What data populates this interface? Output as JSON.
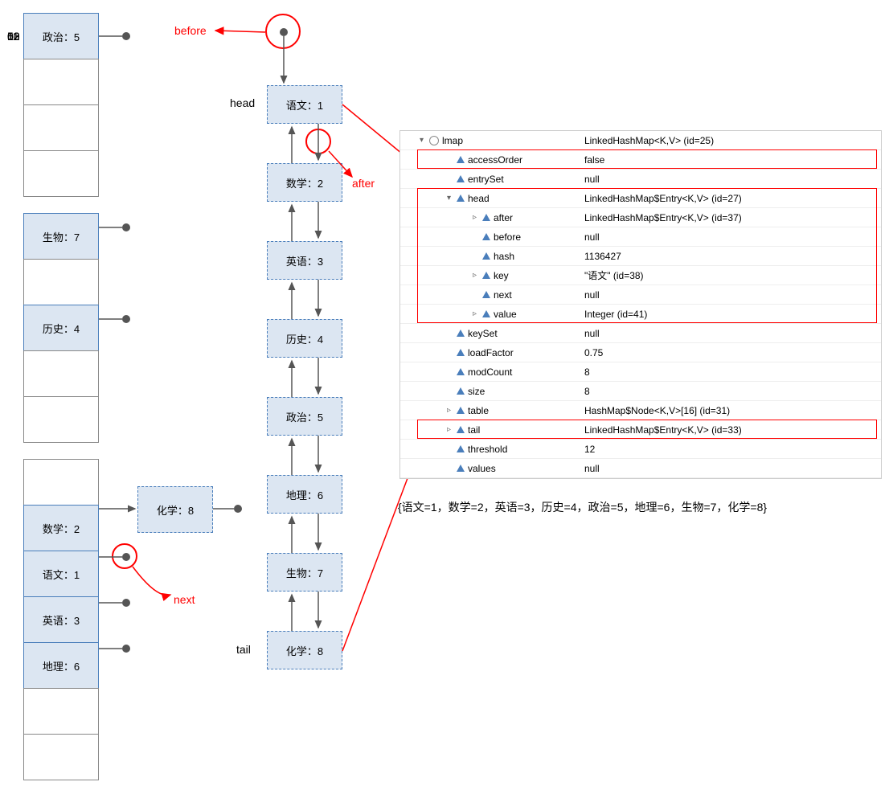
{
  "hash_table": {
    "slots": [
      {
        "index": 0,
        "label": "政治：5",
        "filled": true
      },
      {
        "index": 1,
        "filled": false
      },
      {
        "index": 2,
        "filled": false
      },
      {
        "index": 3,
        "filled": false
      },
      {
        "index": 4,
        "filled": false
      },
      {
        "index": 5,
        "label": "生物：7",
        "filled": true
      },
      {
        "index": 6,
        "filled": false,
        "placeholder": true
      },
      {
        "index": 7,
        "label": "历史：4",
        "filled": true,
        "shown_index": 6
      },
      {
        "index": 8,
        "filled": false
      },
      {
        "index": 9,
        "filled": false
      },
      {
        "index": 10,
        "label": "数学：2",
        "filled": true
      },
      {
        "index": 11,
        "label": "语文：1",
        "filled": true
      },
      {
        "index": 12,
        "label": "英语：3",
        "filled": true
      },
      {
        "index": 13,
        "label": "地理：6",
        "filled": true
      },
      {
        "index": 14,
        "filled": false
      },
      {
        "index": 15,
        "filled": false
      }
    ]
  },
  "chain_node": {
    "label": "化学：8"
  },
  "linked_list": {
    "head_label": "head",
    "tail_label": "tail",
    "nodes": [
      {
        "label": "语文：1"
      },
      {
        "label": "数学：2"
      },
      {
        "label": "英语：3"
      },
      {
        "label": "历史：4"
      },
      {
        "label": "政治：5"
      },
      {
        "label": "地理：6"
      },
      {
        "label": "生物：7"
      },
      {
        "label": "化学：8"
      }
    ]
  },
  "annotations": {
    "before": "before",
    "after": "after",
    "next": "next"
  },
  "inspector": {
    "root": {
      "name": "lmap",
      "value": "LinkedHashMap<K,V>  (id=25)"
    },
    "rows": [
      {
        "indent": 2,
        "arrow": "",
        "name": "accessOrder",
        "value": "false"
      },
      {
        "indent": 2,
        "arrow": "",
        "name": "entrySet",
        "value": "null"
      },
      {
        "indent": 2,
        "arrow": "▾",
        "name": "head",
        "value": "LinkedHashMap$Entry<K,V>  (id=27)"
      },
      {
        "indent": 3,
        "arrow": "▹",
        "name": "after",
        "value": "LinkedHashMap$Entry<K,V>  (id=37)"
      },
      {
        "indent": 3,
        "arrow": "",
        "name": "before",
        "value": "null"
      },
      {
        "indent": 3,
        "arrow": "",
        "name": "hash",
        "value": "1136427"
      },
      {
        "indent": 3,
        "arrow": "▹",
        "name": "key",
        "value": "\"语文\" (id=38)"
      },
      {
        "indent": 3,
        "arrow": "",
        "name": "next",
        "value": "null"
      },
      {
        "indent": 3,
        "arrow": "▹",
        "name": "value",
        "value": "Integer  (id=41)"
      },
      {
        "indent": 2,
        "arrow": "",
        "name": "keySet",
        "value": "null"
      },
      {
        "indent": 2,
        "arrow": "",
        "name": "loadFactor",
        "value": "0.75"
      },
      {
        "indent": 2,
        "arrow": "",
        "name": "modCount",
        "value": "8"
      },
      {
        "indent": 2,
        "arrow": "",
        "name": "size",
        "value": "8"
      },
      {
        "indent": 2,
        "arrow": "▹",
        "name": "table",
        "value": "HashMap$Node<K,V>[16]  (id=31)"
      },
      {
        "indent": 2,
        "arrow": "▹",
        "name": "tail",
        "value": "LinkedHashMap$Entry<K,V>  (id=33)"
      },
      {
        "indent": 2,
        "arrow": "",
        "name": "threshold",
        "value": "12"
      },
      {
        "indent": 2,
        "arrow": "",
        "name": "values",
        "value": "null"
      }
    ]
  },
  "output": "{语文=1，数学=2，英语=3，历史=4，政治=5，地理=6，生物=7，化学=8}"
}
